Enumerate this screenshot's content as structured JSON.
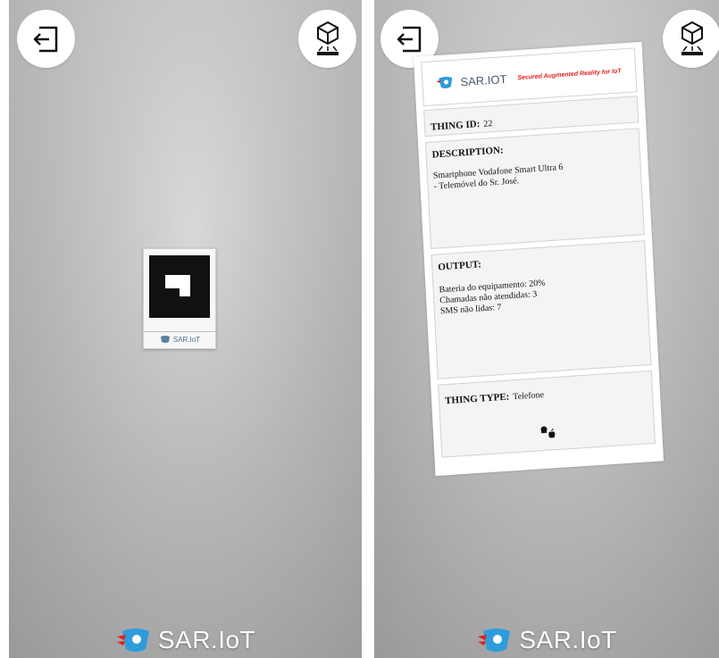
{
  "brand": {
    "name": "SAR.IoT",
    "marker_name": "SAR.IoT",
    "header_name": "SAR.IOT",
    "accent": "#2d9cdb",
    "red": "#e02020"
  },
  "icons": {
    "exit": "exit-icon",
    "model": "3d-model-icon",
    "logo": "sar-iot-logo-icon",
    "os": "android-apple-icon"
  },
  "ar_card": {
    "tagline": "Secured Augmented Reality for IoT",
    "thing_id": {
      "label": "THING ID:",
      "value": "22"
    },
    "description": {
      "label": "DESCRIPTION:",
      "lines": [
        "Smartphone Vodafone Smart Ultra 6",
        "- Telemóvel do Sr. José."
      ]
    },
    "output": {
      "label": "OUTPUT:",
      "lines": [
        "Bateria do equipamento: 20%",
        "Chamadas não atendidas: 3",
        "SMS não lidas: 7"
      ]
    },
    "thing_type": {
      "label": "THING TYPE:",
      "value": "Telefone"
    }
  }
}
